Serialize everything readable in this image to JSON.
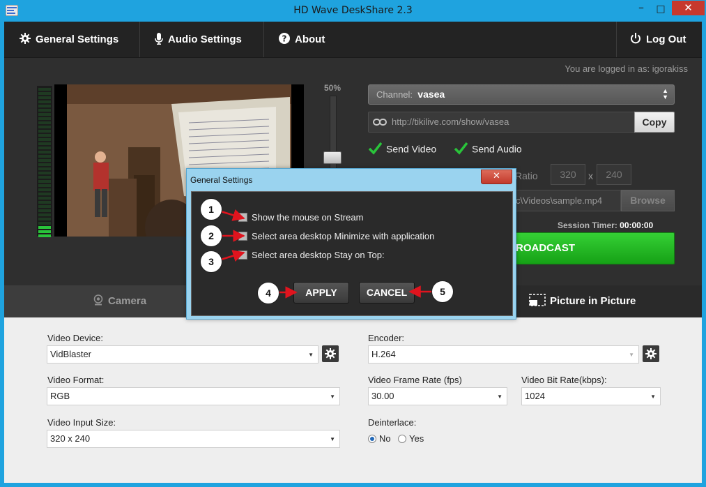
{
  "window": {
    "title": "HD Wave DeskShare 2.3",
    "minimize_glyph": "–",
    "maximize_glyph": "□",
    "close_glyph": "✕"
  },
  "menu": {
    "general_settings": "General Settings",
    "audio_settings": "Audio Settings",
    "about": "About",
    "log_out": "Log Out"
  },
  "session": {
    "logged_in_text": "You are logged in as:  igorakiss"
  },
  "channel": {
    "label": "Channel:",
    "value": "vasea"
  },
  "share": {
    "url": "http://tikilive.com/show/vasea",
    "copy_label": "Copy"
  },
  "options": {
    "send_video": "Send Video",
    "send_audio": "Send Audio",
    "ratio_label": "Ratio",
    "width": "320",
    "times": "x",
    "height": "240",
    "file_path": "c\\Videos\\sample.mp4",
    "browse_label": "Browse"
  },
  "zoom": {
    "level": "50%"
  },
  "broadcast": {
    "timer_label": "Session Timer:",
    "timer_value": "00:00:00",
    "button_label": "ROADCAST"
  },
  "tabs": {
    "camera": "Camera",
    "picture_in_picture": "Picture in Picture"
  },
  "settings": {
    "video_device_label": "Video Device:",
    "video_device_value": "VidBlaster",
    "video_format_label": "Video Format:",
    "video_format_value": "RGB",
    "video_input_size_label": "Video Input Size:",
    "video_input_size_value": "320 x 240",
    "encoder_label": "Encoder:",
    "encoder_value": "H.264",
    "frame_rate_label": "Video Frame Rate (fps)",
    "frame_rate_value": "30.00",
    "bit_rate_label": "Video Bit Rate(kbps):",
    "bit_rate_value": "1024",
    "deinterlace_label": "Deinterlace:",
    "deinterlace_no": "No",
    "deinterlace_yes": "Yes"
  },
  "dialog": {
    "title": "General Settings",
    "close_glyph": "✕",
    "option_1": "Show the mouse on Stream",
    "option_2": "Select area desktop Minimize with application",
    "option_3": "Select area desktop Stay on Top:",
    "apply_label": "APPLY",
    "cancel_label": "CANCEL"
  },
  "callouts": [
    "1",
    "2",
    "3",
    "4",
    "5"
  ],
  "colors": {
    "window_frame": "#1fa3df",
    "accent_green": "#29c43a",
    "close_red": "#c7392d",
    "callout_arrow": "#e0141e"
  }
}
